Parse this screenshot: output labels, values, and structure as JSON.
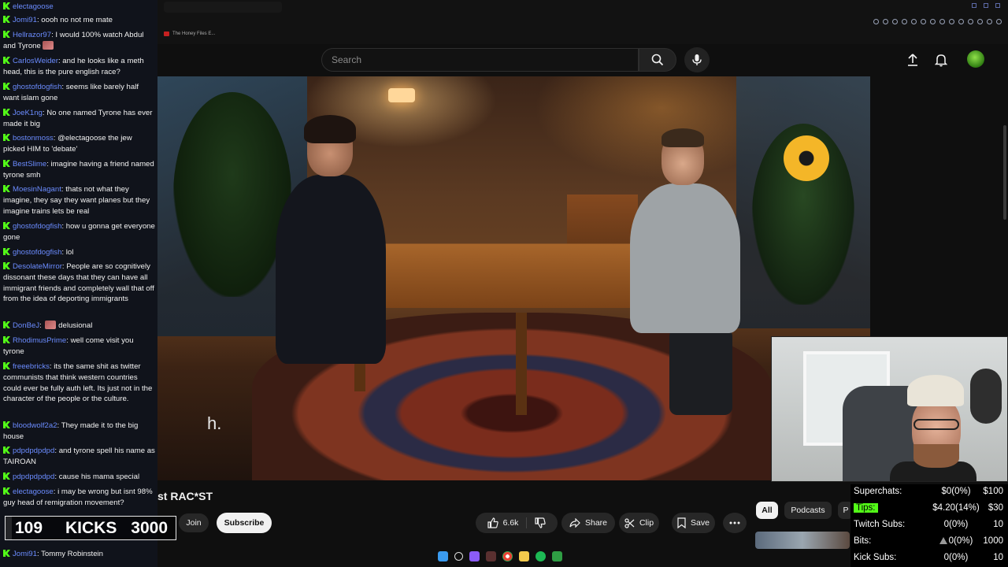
{
  "browser": {
    "bookmark_label": "The Honey Files E..."
  },
  "header": {
    "search_placeholder": "Search"
  },
  "video": {
    "caption_fragment": "h.",
    "title": "st RAC*ST",
    "join_label": "Join",
    "subscribe_label": "Subscribe",
    "like_count": "6.6k",
    "share_label": "Share",
    "clip_label": "Clip",
    "save_label": "Save"
  },
  "chips": [
    "All",
    "Podcasts",
    "P"
  ],
  "chat": {
    "messages": [
      {
        "user": "electagoose",
        "text": ""
      },
      {
        "user": "Jomi91",
        "text": "oooh no not me mate"
      },
      {
        "user": "Hellrazor97",
        "text": "I would 100% watch Abdul and Tyrone",
        "emote": true
      },
      {
        "user": "CarlosWeider",
        "text": "and he looks like a meth head, this is the pure english race?"
      },
      {
        "user": "ghostofdogfish",
        "text": "seems like barely half want islam gone"
      },
      {
        "user": "JoeK1ng",
        "text": "No one named Tyrone has ever made it big"
      },
      {
        "user": "bostonmoss",
        "text": "@electagoose the jew picked HIM to 'debate'"
      },
      {
        "user": "BestSlime",
        "text": "imagine having a friend named tyrone smh"
      },
      {
        "user": "MoesinNagant",
        "text": "thats not what they imagine, they say they want planes but they imagine trains lets be real"
      },
      {
        "user": "ghostofdogfish",
        "text": "how u gonna get everyone gone"
      },
      {
        "user": "ghostofdogfish",
        "text": "lol"
      },
      {
        "user": "DesolateMirror",
        "text": "People are so cognitively dissonant these days that they can have all immigrant friends and completely wall that off from the idea of deporting immigrants"
      },
      {
        "user": "DonBeJ",
        "text": "delusional",
        "emote": true
      },
      {
        "user": "RhodimusPrime",
        "text": "well come visit you tyrone"
      },
      {
        "user": "freeebricks",
        "text": "its the same shit as twitter communists that think western countries could ever be fully auth left. Its just not in the character of the people or the culture."
      },
      {
        "user": "bloodwolf2a2",
        "text": "They made it to the big house"
      },
      {
        "user": "pdpdpdpdpd",
        "text": "and tyrone spell his name as TAIROAN"
      },
      {
        "user": "pdpdpdpdpd",
        "text": "cause his mama special"
      },
      {
        "user": "electagoose",
        "text": "i may be wrong but isnt 98% guy head of remigration movement?"
      },
      {
        "user": "Jomi91",
        "text": "Tommy Robinstein"
      }
    ]
  },
  "kicks_goal": {
    "current": "109",
    "label": "KICKS",
    "target": "3000",
    "progress_fraction": 0.036
  },
  "stats": [
    {
      "label": "Superchats:",
      "value": "$0(0%)",
      "goal": "$100"
    },
    {
      "label": "Tips:",
      "value": "$4.20(14%)",
      "goal": "$30"
    },
    {
      "label": "Twitch Subs:",
      "value": "0(0%)",
      "goal": "10"
    },
    {
      "label": "Bits:",
      "value": "0(0%)",
      "goal": "1000"
    },
    {
      "label": "Kick Subs:",
      "value": "0(0%)",
      "goal": "10"
    }
  ],
  "colors": {
    "kick_green": "#53fc18",
    "username_blue": "#6b8cff",
    "yt_bg": "#0f0f0f"
  }
}
